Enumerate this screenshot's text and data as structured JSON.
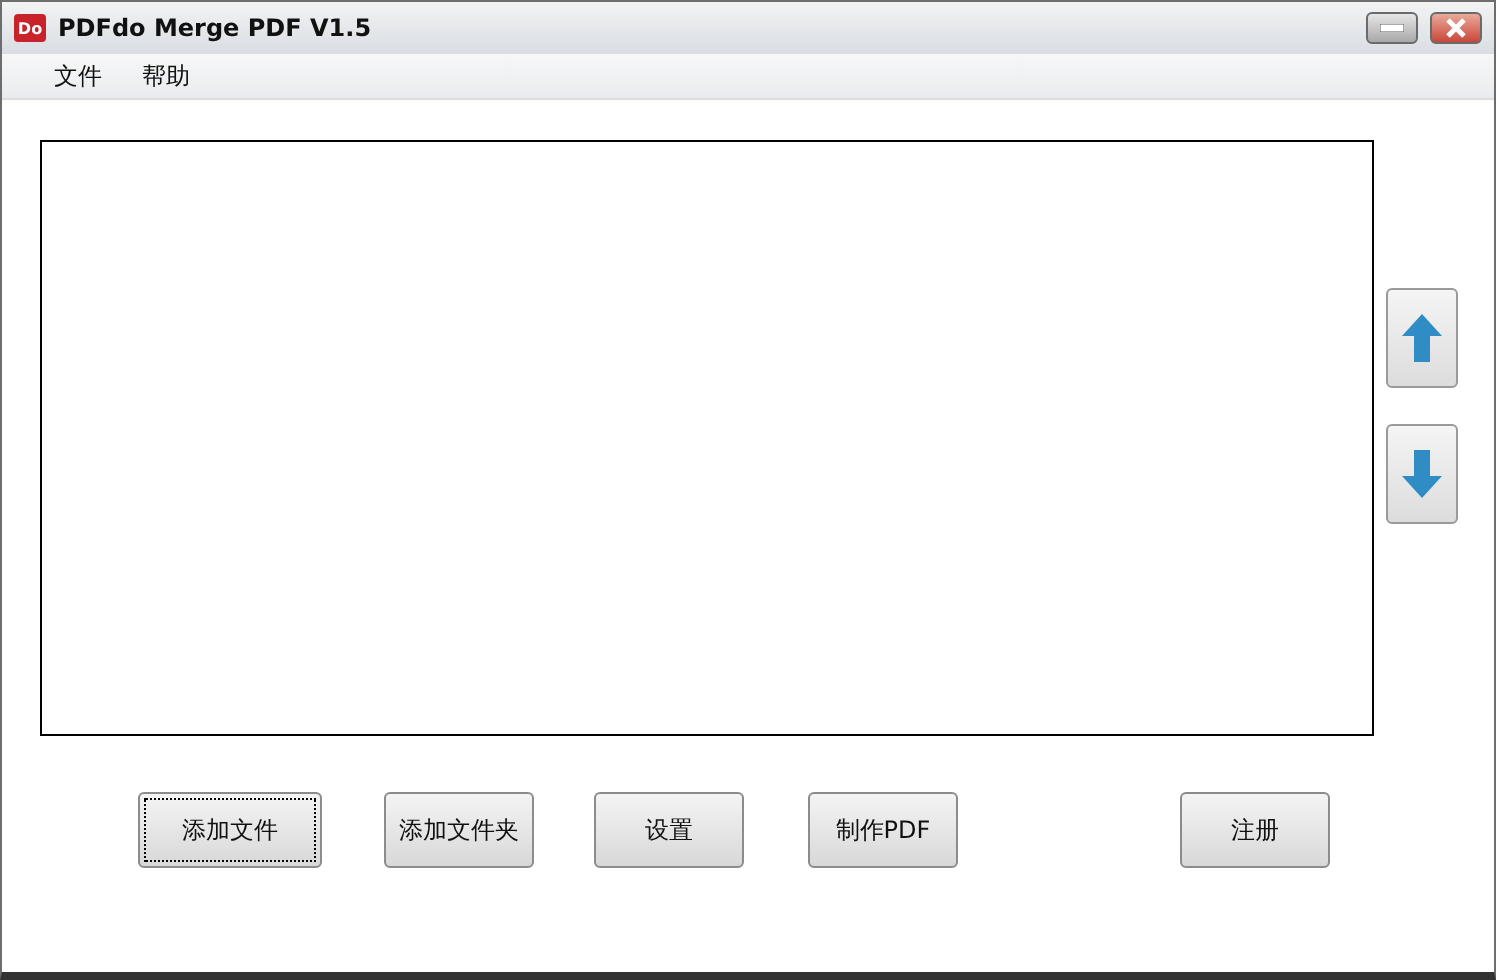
{
  "window": {
    "title": "PDFdo Merge PDF V1.5",
    "app_icon": "Do"
  },
  "menu": [
    {
      "label": "文件"
    },
    {
      "label": "帮助"
    }
  ],
  "side_buttons": [
    {
      "kind": "up"
    },
    {
      "kind": "down"
    }
  ],
  "buttons": [
    {
      "label": "添加文件",
      "focused": true
    },
    {
      "label": "添加文件夹",
      "focused": false
    },
    {
      "label": "设置",
      "focused": false
    },
    {
      "label": "制作PDF",
      "focused": false
    },
    {
      "label": "注册",
      "focused": false
    }
  ]
}
